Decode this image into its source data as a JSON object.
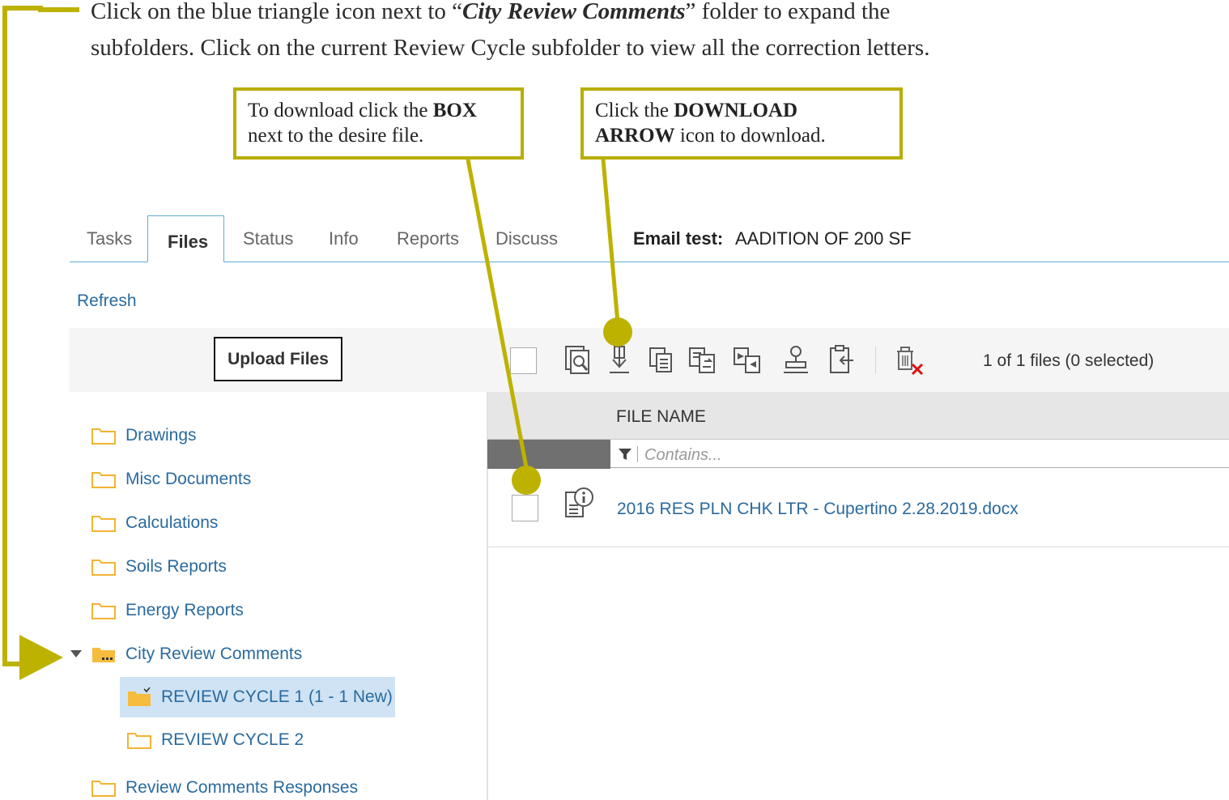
{
  "instructions": {
    "line1_start": "Click on the blue triangle icon next to “",
    "line1_emph": "City Review Comments",
    "line1_end": "” folder to expand the",
    "line2": "subfolders.  Click on the current Review Cycle subfolder to view all the correction letters."
  },
  "callouts": {
    "box": {
      "pre": "To download click the ",
      "bold": "BOX",
      "post": "next to the desire file."
    },
    "arrow": {
      "pre": "Click the ",
      "bold1": "DOWNLOAD",
      "bold2": "ARROW",
      "post": " icon to download."
    }
  },
  "tabs": [
    {
      "label": "Tasks"
    },
    {
      "label": "Files",
      "active": true
    },
    {
      "label": "Status"
    },
    {
      "label": "Info"
    },
    {
      "label": "Reports"
    },
    {
      "label": "Discuss"
    }
  ],
  "project": {
    "label": "Email test:",
    "value": "AADITION OF 200 SF"
  },
  "refresh_label": "Refresh",
  "upload_label": "Upload Files",
  "toolbar": {
    "icons": [
      "preview-icon",
      "download-arrow-icon",
      "copy-icon",
      "copy-move-icon",
      "replace-icon",
      "stamp-icon",
      "clipboard-return-icon",
      "delete-icon"
    ],
    "file_count": "1 of 1 files (0 selected)"
  },
  "grid": {
    "header": "FILE NAME",
    "filter_placeholder": "Contains...",
    "rows": [
      {
        "name": "2016 RES PLN CHK LTR - Cupertino 2.28.2019.docx",
        "icon": "file-info-icon"
      }
    ]
  },
  "folders": [
    {
      "label": "Drawings"
    },
    {
      "label": "Misc Documents"
    },
    {
      "label": "Calculations"
    },
    {
      "label": "Soils Reports"
    },
    {
      "label": "Energy Reports"
    },
    {
      "label": "City Review Comments",
      "expanded": true,
      "children": [
        {
          "label": "REVIEW CYCLE 1 (1 - 1 New)",
          "selected": true
        },
        {
          "label": "REVIEW CYCLE 2"
        }
      ]
    },
    {
      "label": "Review Comments Responses"
    }
  ],
  "colors": {
    "annotation": "#bdb200",
    "link": "#2a6a9e",
    "selected": "#cfe3f4",
    "folder": "#f6bc3e",
    "tab_border": "#5eaed0"
  }
}
